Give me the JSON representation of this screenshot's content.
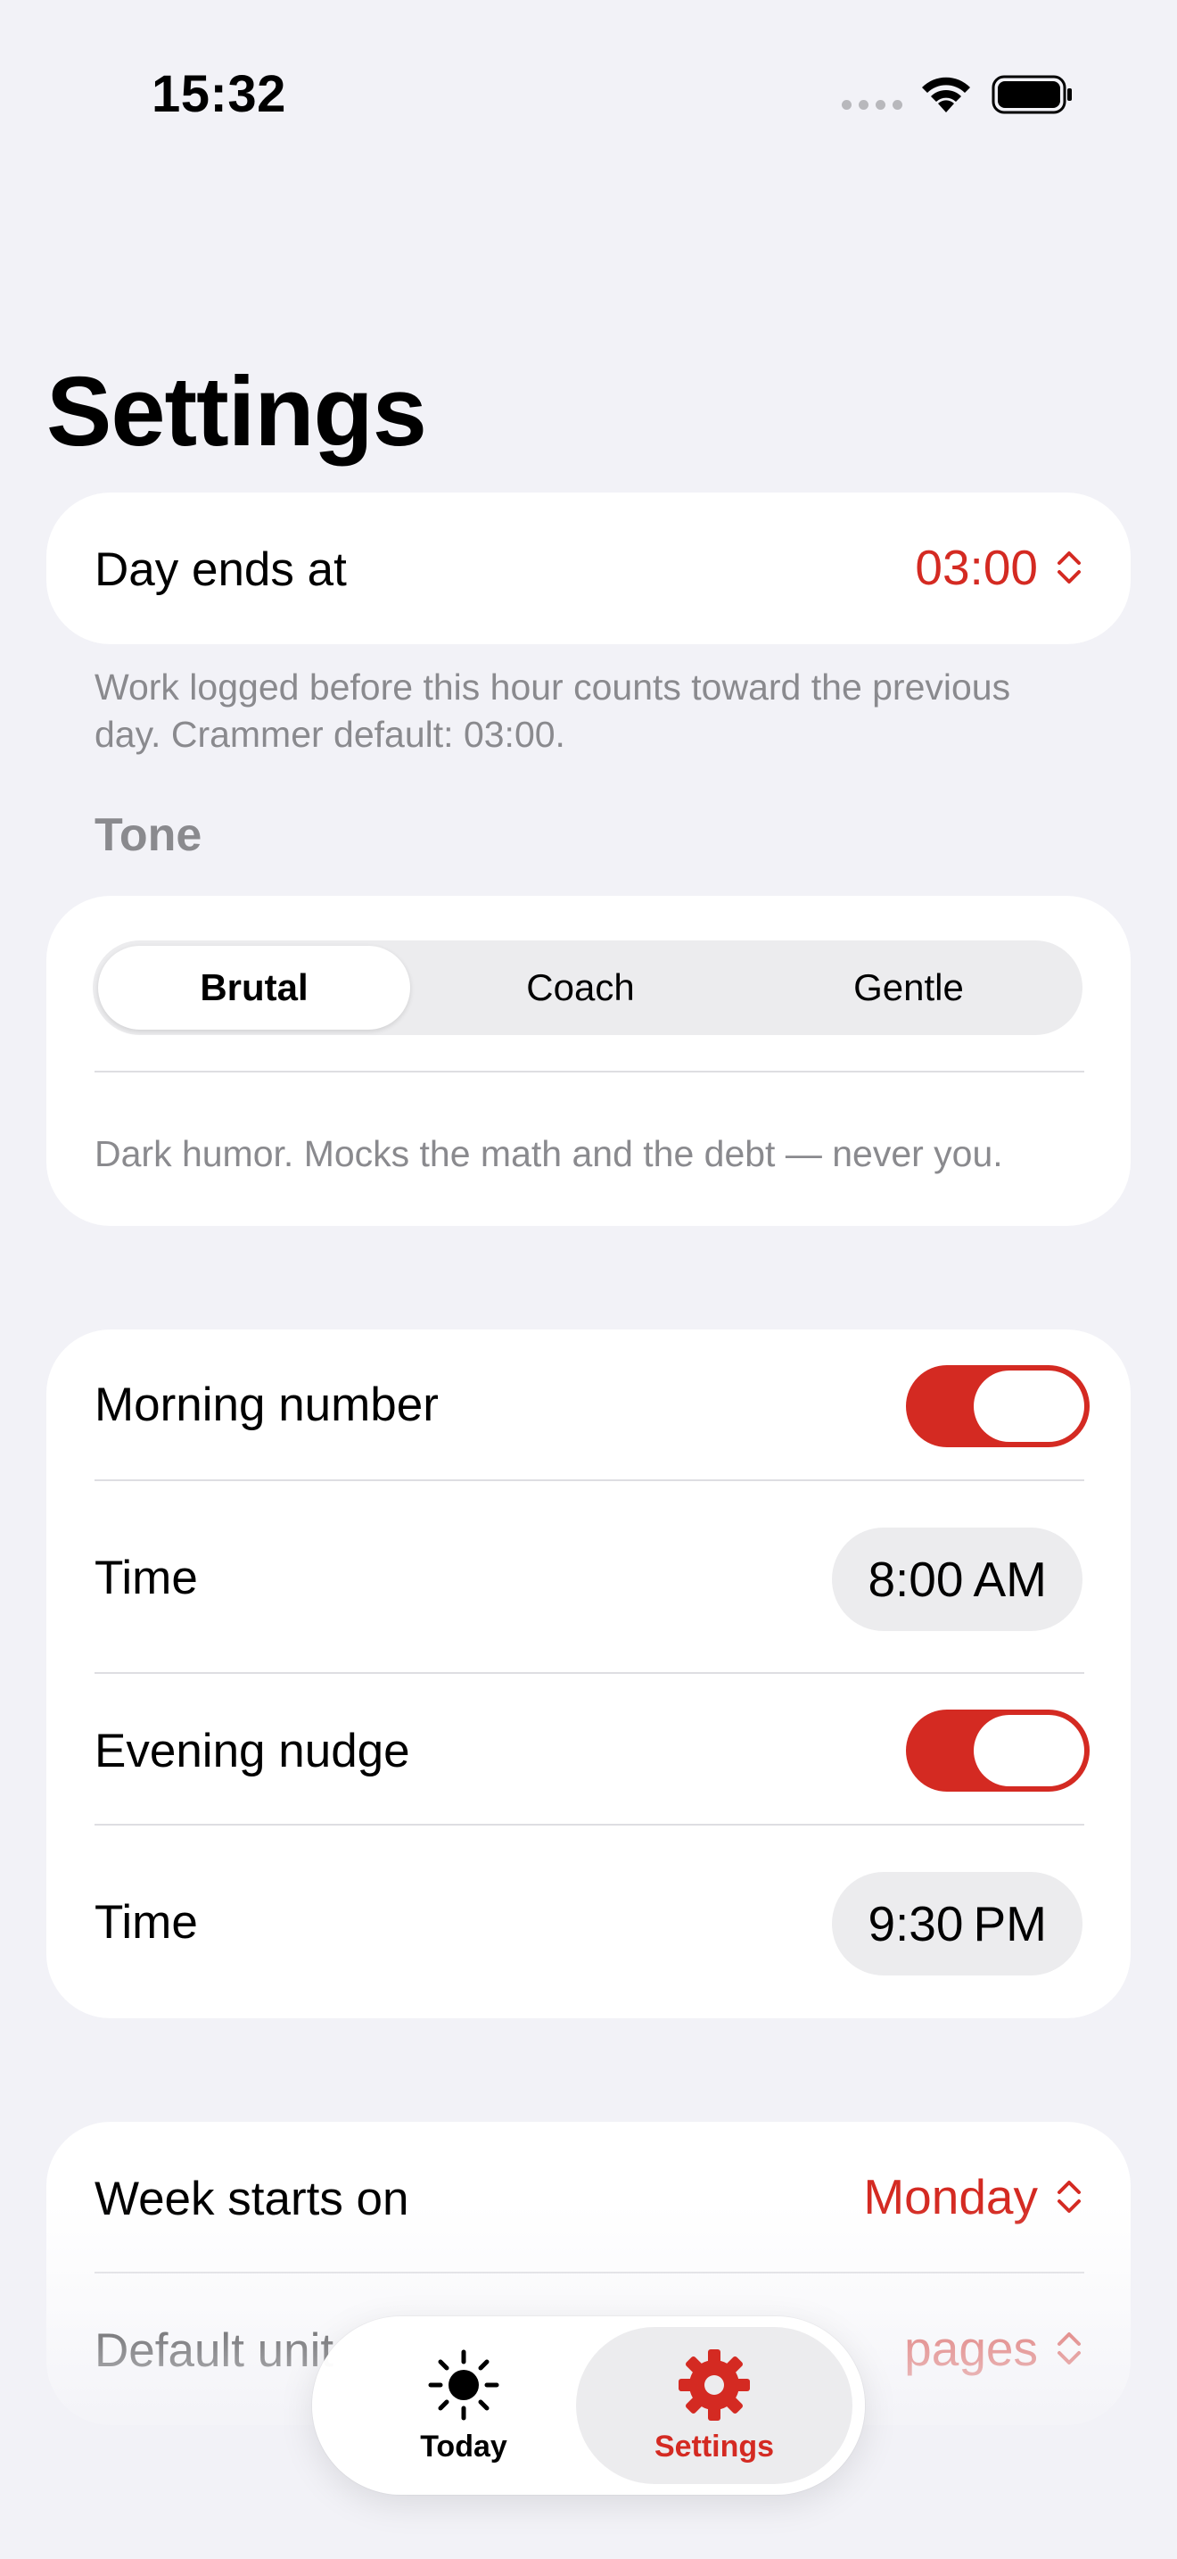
{
  "status_bar": {
    "time": "15:32"
  },
  "title": "Settings",
  "day_end": {
    "label": "Day ends at",
    "value": "03:00",
    "footnote": "Work logged before this hour counts toward the previous day. Crammer default: 03:00."
  },
  "tone": {
    "header": "Tone",
    "options": [
      "Brutal",
      "Coach",
      "Gentle"
    ],
    "selected": "Brutal",
    "description": "Dark humor. Mocks the math and the debt — never you."
  },
  "notifications": {
    "morning": {
      "label": "Morning number",
      "enabled": true
    },
    "morning_time": {
      "label": "Time",
      "value": "8:00 AM"
    },
    "evening": {
      "label": "Evening nudge",
      "enabled": true
    },
    "evening_time": {
      "label": "Time",
      "value": "9:30 PM"
    }
  },
  "general": {
    "week_start": {
      "label": "Week starts on",
      "value": "Monday"
    },
    "default_unit": {
      "label": "Default unit",
      "value": "pages"
    }
  },
  "tabbar": {
    "today": {
      "label": "Today",
      "icon": "sun-icon"
    },
    "settings": {
      "label": "Settings",
      "icon": "gear-icon"
    },
    "active": "settings"
  },
  "colors": {
    "accent": "#d42a22",
    "background": "#f2f2f7",
    "secondary_text": "#8a8a8e"
  }
}
